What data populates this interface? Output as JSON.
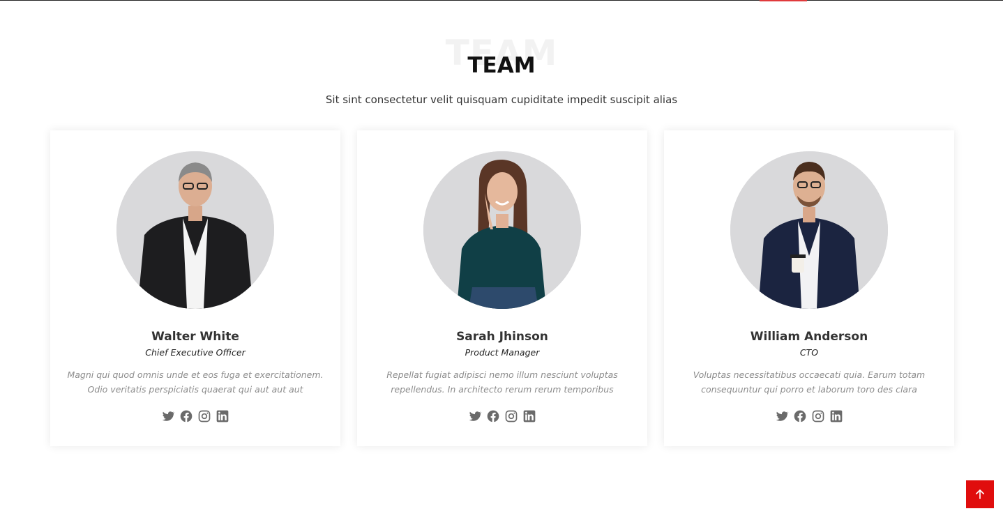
{
  "section": {
    "ghost_title": "TEAM",
    "title": "TEAM",
    "subtitle": "Sit sint consectetur velit quisquam cupiditate impedit suscipit alias"
  },
  "team": [
    {
      "name": "Walter White",
      "role": "Chief Executive Officer",
      "bio": "Magni qui quod omnis unde et eos fuga et exercitationem. Odio veritatis perspiciatis quaerat qui aut aut aut"
    },
    {
      "name": "Sarah Jhinson",
      "role": "Product Manager",
      "bio": "Repellat fugiat adipisci nemo illum nesciunt voluptas repellendus. In architecto rerum rerum temporibus"
    },
    {
      "name": "William Anderson",
      "role": "CTO",
      "bio": "Voluptas necessitatibus occaecati quia. Earum totam consequuntur qui porro et laborum toro des clara"
    }
  ],
  "social_icons": [
    "twitter-icon",
    "facebook-icon",
    "instagram-icon",
    "linkedin-icon"
  ],
  "colors": {
    "accent": "#e00d0d",
    "text_dark": "#111111",
    "text_muted": "#8c8c8c",
    "icon": "#6a6a6a"
  }
}
